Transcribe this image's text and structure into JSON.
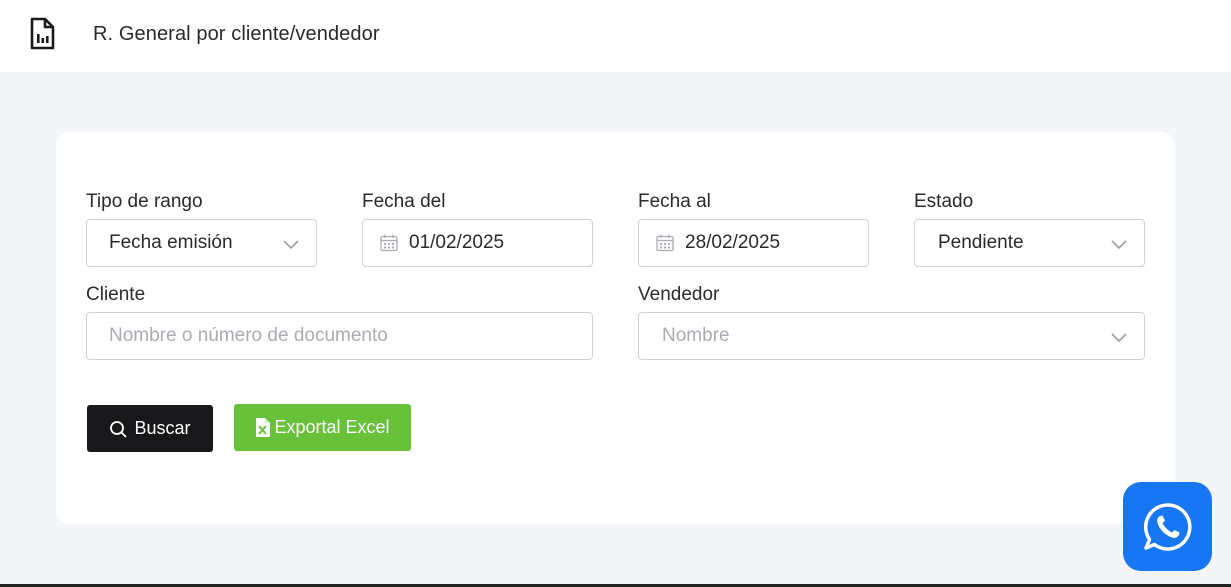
{
  "header": {
    "title": "R. General por cliente/vendedor",
    "icon": "report-document-icon"
  },
  "filters": {
    "range_type": {
      "label": "Tipo de rango",
      "value": "Fecha emisión"
    },
    "date_from": {
      "label": "Fecha del",
      "value": "01/02/2025"
    },
    "date_to": {
      "label": "Fecha al",
      "value": "28/02/2025"
    },
    "status": {
      "label": "Estado",
      "value": "Pendiente"
    },
    "client": {
      "label": "Cliente",
      "placeholder": "Nombre o número de documento"
    },
    "seller": {
      "label": "Vendedor",
      "placeholder": "Nombre"
    }
  },
  "actions": {
    "search_label": "Buscar",
    "export_label": "Exportal Excel"
  },
  "colors": {
    "search_button": "#18181a",
    "export_button": "#67c23a",
    "whatsapp": "#1676f3"
  }
}
